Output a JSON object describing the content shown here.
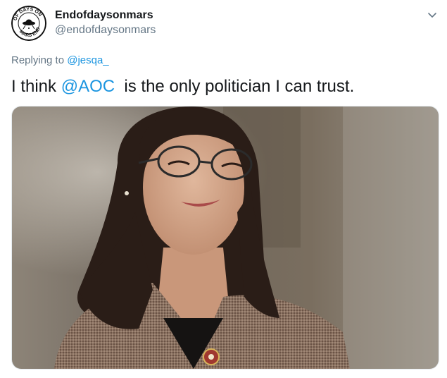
{
  "tweet": {
    "author": {
      "display_name": "Endofdaysonmars",
      "handle": "@endofdaysonmars",
      "avatar_text": "OF DAYS ON MARS END"
    },
    "menu_icon": "chevron-down-icon",
    "reply": {
      "prefix": "Replying to",
      "to": "@jesqa_"
    },
    "text": {
      "before": "I think ",
      "mention": "@AOC",
      "after": "  is the only politician I can trust."
    },
    "media": {
      "kind": "photo"
    }
  },
  "colors": {
    "link": "#1b95e0",
    "secondary": "#657786",
    "primary_text": "#14171a"
  }
}
